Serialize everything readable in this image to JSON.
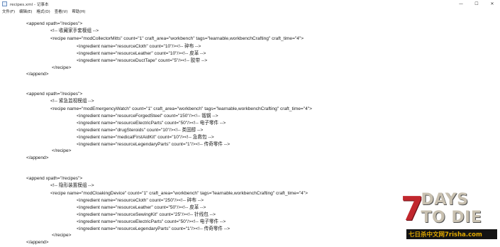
{
  "window": {
    "title": "recipes.xml - 记事本",
    "controls": {
      "minimize": "—",
      "maximize": "☐",
      "close": "✕"
    }
  },
  "menu": [
    "文件(F)",
    "编辑(E)",
    "格式(O)",
    "查看(V)",
    "帮助(H)"
  ],
  "lines": [
    "<append xpath=\"/recipes\">",
    "<!-- 收藏家手套模组 -->",
    "<recipe name=\"modCollectorMitts\" count=\"1\" craft_area=\"workbench\" tags=\"learnable,workbenchCrafting\" craft_time=\"4\">",
    "<ingredient name=\"resourceCloth\" count=\"10\"/><!-- 碎布 -->",
    "<ingredient name=\"resourceLeather\" count=\"10\"/><!-- 皮革 -->",
    "<ingredient name=\"resourceDuctTape\" count=\"5\"/><!-- 胶带 -->",
    "</recipe>",
    "</append>",
    "<append xpath=\"/recipes\">",
    "<!-- 紧急监视模组 -->",
    "<recipe name=\"modEmergencyWatch\" count=\"1\" craft_area=\"workbench\" tags=\"learnable,workbenchCrafting\" craft_time=\"4\">",
    "<ingredient name=\"resourceForgedSteel\" count=\"150\"/><!-- 锻钢 -->",
    "<ingredient name=\"resourceElectricParts\" count=\"50\"/><!-- 电子零件 -->",
    "<ingredient name=\"drugSteroids\" count=\"10\"/><!-- 类固醇 -->",
    "<ingredient name=\"medicalFirstAidKit\" count=\"10\"/><!-- 急救包 -->",
    "<ingredient name=\"resourceLegendaryParts\" count=\"1\"/><!-- 传奇零件 -->",
    "</recipe>",
    "</append>",
    "<append xpath=\"/recipes\">",
    "<!-- 隐形装置模组 -->",
    "<recipe name=\"modCloakingDevice\" count=\"1\" craft_area=\"workbench\" tags=\"learnable,workbenchCrafting\" craft_time=\"4\">",
    "<ingredient name=\"resourceCloth\" count=\"250\"/><!-- 碎布 -->",
    "<ingredient name=\"resourceLeather\" count=\"50\"/><!-- 皮革 -->",
    "<ingredient name=\"resourceSewingKit\" count=\"25\"/><!-- 针线包 -->",
    "<ingredient name=\"resourceElectricParts\" count=\"50\"/><!-- 电子零件 -->",
    "<ingredient name=\"resourceLegendaryParts\" count=\"1\"/><!-- 传奇零件 -->",
    "</recipe>",
    "</append>"
  ],
  "watermark": {
    "logo_number": "7",
    "logo_text": "DAYS TO DIE",
    "subtitle": "七日杀中文网7risha.com"
  }
}
